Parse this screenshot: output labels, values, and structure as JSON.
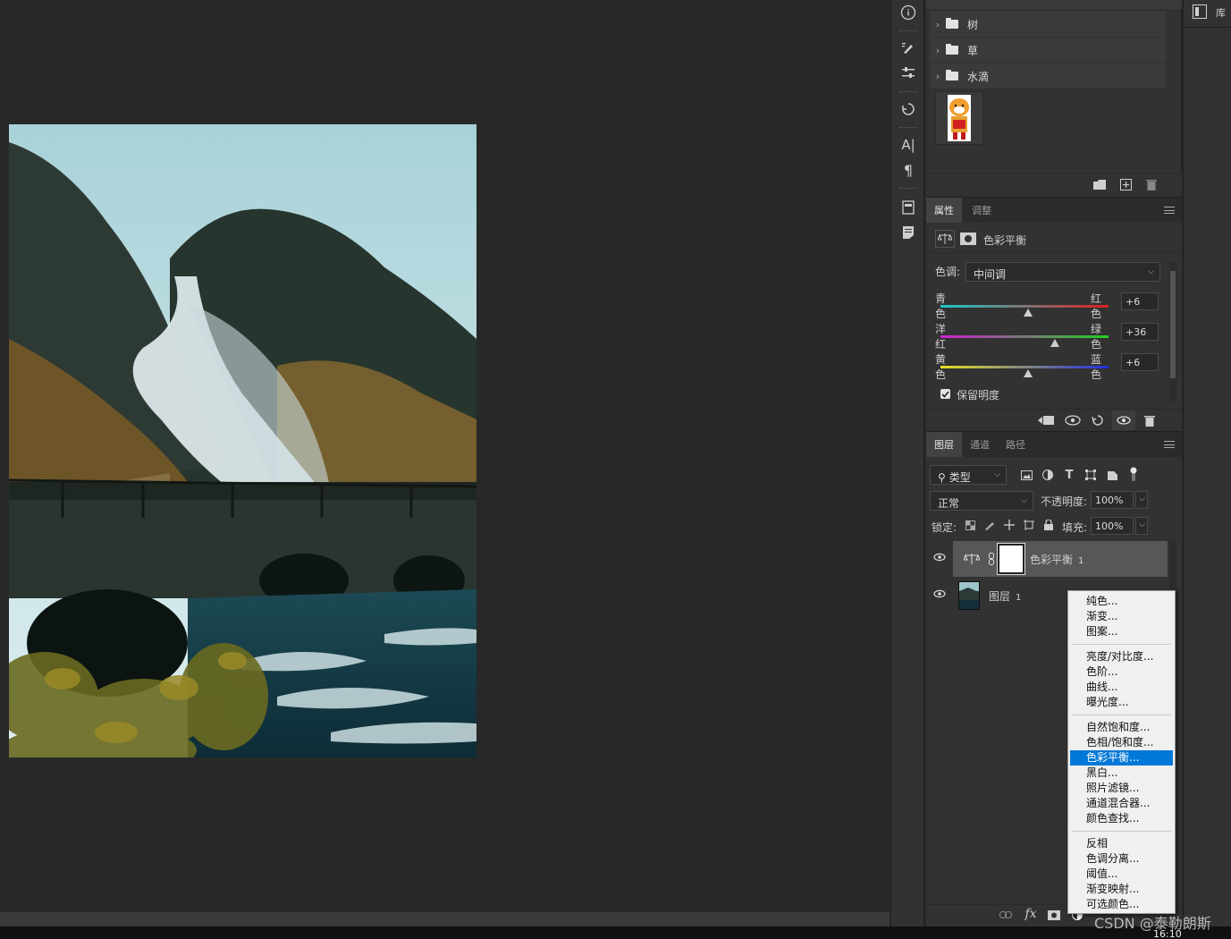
{
  "layers_top": {
    "groups": [
      {
        "name": "树"
      },
      {
        "name": "草"
      },
      {
        "name": "水滴"
      }
    ]
  },
  "properties": {
    "tabs": [
      "属性",
      "调整"
    ],
    "adjustment_name": "色彩平衡",
    "tone_label": "色调:",
    "tone_value": "中间调",
    "sliders": [
      {
        "left": "青色",
        "right": "红色",
        "value": "+6",
        "level": 0.52,
        "gradient": [
          "#18c8c8",
          "#e02020"
        ]
      },
      {
        "left": "洋红",
        "right": "绿色",
        "value": "+36",
        "level": 0.68,
        "gradient": [
          "#d020d0",
          "#20d020"
        ]
      },
      {
        "left": "黄色",
        "right": "蓝色",
        "value": "+6",
        "level": 0.52,
        "gradient": [
          "#e8e020",
          "#2030e0"
        ]
      }
    ],
    "preserve_luminosity": "保留明度",
    "preserve_checked": true
  },
  "layers_panel": {
    "tabs": [
      "图层",
      "通道",
      "路径"
    ],
    "filter_type": "类型",
    "blend_mode": "正常",
    "opacity_label": "不透明度:",
    "opacity_value": "100%",
    "lock_label": "锁定:",
    "fill_label": "填充:",
    "fill_value": "100%",
    "layers": [
      {
        "name": "色彩平衡",
        "num": "1"
      },
      {
        "name": "图层",
        "num": "1"
      }
    ],
    "fx_label": "fx"
  },
  "context_menu": {
    "groups": [
      [
        "纯色...",
        "渐变...",
        "图案..."
      ],
      [
        "亮度/对比度...",
        "色阶...",
        "曲线...",
        "曝光度..."
      ],
      [
        "自然饱和度...",
        "色相/饱和度...",
        "色彩平衡...",
        "黑白...",
        "照片滤镜...",
        "通道混合器...",
        "颜色查找..."
      ],
      [
        "反相",
        "色调分离...",
        "阈值...",
        "渐变映射...",
        "可选颜色..."
      ]
    ],
    "selected": "色彩平衡..."
  },
  "far_right": {
    "label": "库"
  },
  "watermark": "CSDN @泰勒朗斯",
  "clock": "16:10"
}
